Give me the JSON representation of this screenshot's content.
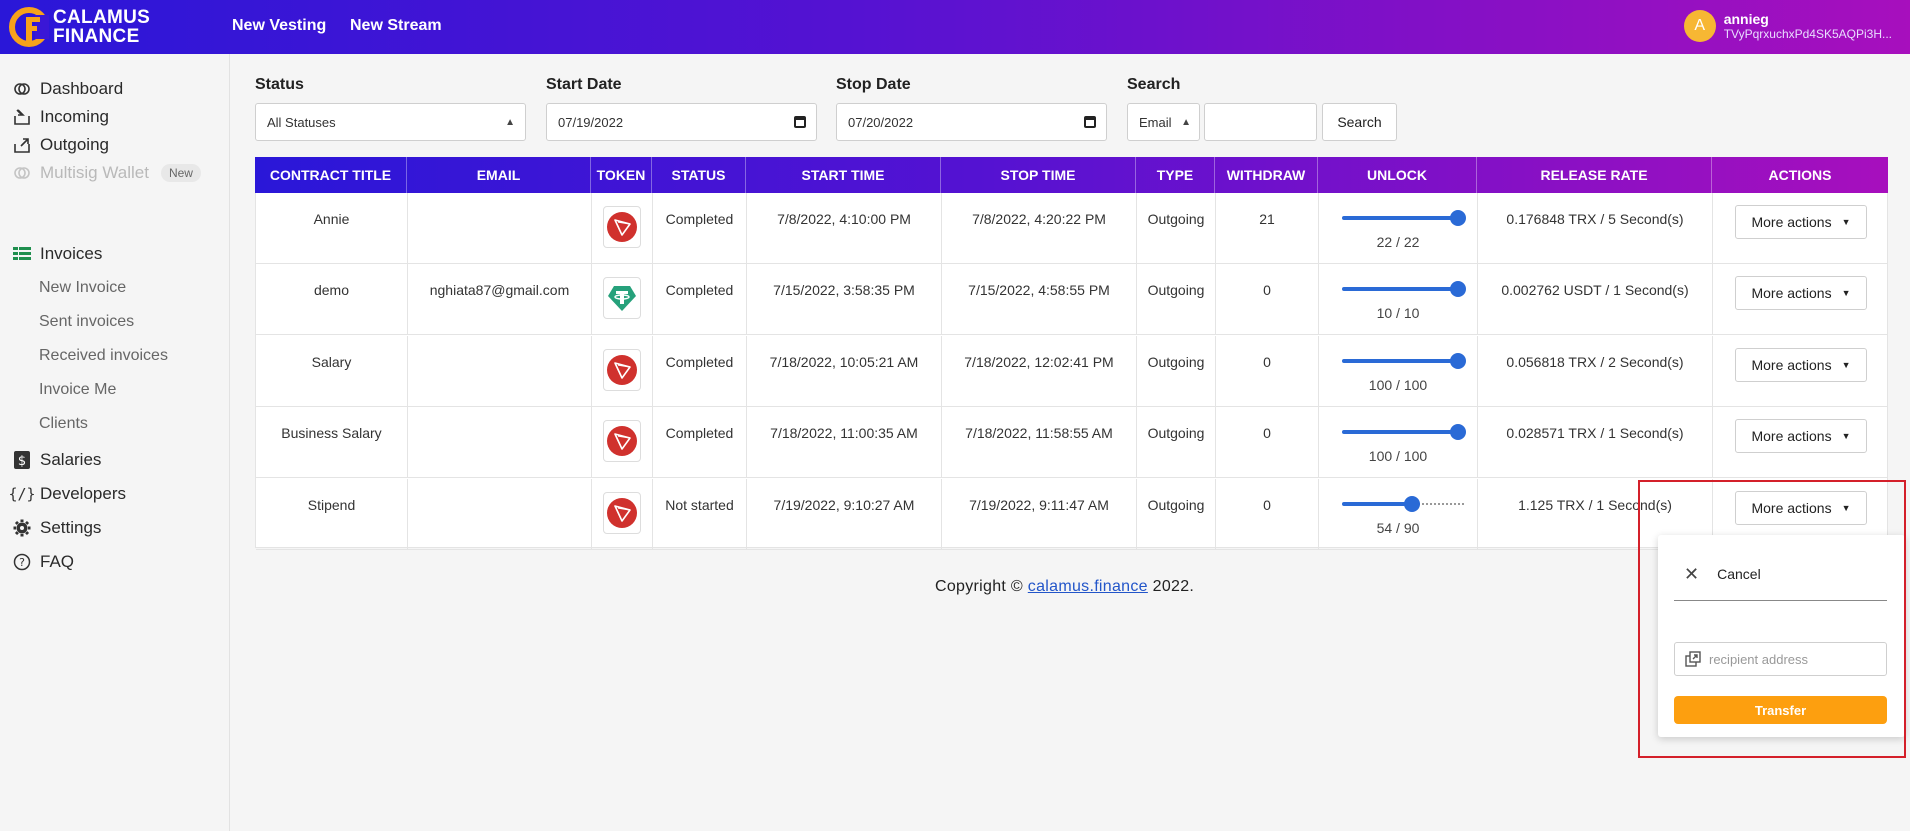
{
  "header": {
    "brand_line1": "CALAMUS",
    "brand_line2": "FINANCE",
    "nav": [
      "New Vesting",
      "New Stream"
    ],
    "user_initial": "A",
    "user_name": "annieg",
    "user_address": "TVyPqrxuchxPd4SK5AQPi3H..."
  },
  "sidebar": {
    "items": [
      {
        "label": "Dashboard",
        "icon": "dashboard-icon"
      },
      {
        "label": "Incoming",
        "icon": "incoming-icon"
      },
      {
        "label": "Outgoing",
        "icon": "outgoing-icon"
      },
      {
        "label": "Multisig Wallet",
        "icon": "multisig-icon",
        "badge": "New"
      },
      {
        "label": "Invoices",
        "icon": "invoices-icon"
      },
      {
        "label": "Salaries",
        "icon": "salaries-icon"
      },
      {
        "label": "Developers",
        "icon": "developers-icon"
      },
      {
        "label": "Settings",
        "icon": "gear-icon"
      },
      {
        "label": "FAQ",
        "icon": "help-icon"
      }
    ],
    "invoice_sub": [
      "New Invoice",
      "Sent invoices",
      "Received invoices",
      "Invoice Me",
      "Clients"
    ]
  },
  "filters": {
    "status_label": "Status",
    "status_value": "All Statuses",
    "start_label": "Start Date",
    "start_value": "07/19/2022",
    "stop_label": "Stop Date",
    "stop_value": "07/20/2022",
    "search_label": "Search",
    "search_type": "Email",
    "search_value": "",
    "search_button": "Search"
  },
  "table": {
    "columns": [
      "CONTRACT TITLE",
      "EMAIL",
      "TOKEN",
      "STATUS",
      "START TIME",
      "STOP TIME",
      "TYPE",
      "WITHDRAW",
      "UNLOCK",
      "RELEASE RATE",
      "ACTIONS"
    ],
    "rows": [
      {
        "title": "Annie",
        "email": "",
        "token": "tron-icon",
        "status": "Completed",
        "start": "7/8/2022, 4:10:00 PM",
        "stop": "7/8/2022, 4:20:22 PM",
        "type": "Outgoing",
        "withdraw": "21",
        "unlock": "22 / 22",
        "unlock_fraction": 1.0,
        "rate": "0.176848 TRX / 5 Second(s)",
        "action": "More actions"
      },
      {
        "title": "demo",
        "email": "nghiata87@gmail.com",
        "token": "tether-icon",
        "status": "Completed",
        "start": "7/15/2022, 3:58:35 PM",
        "stop": "7/15/2022, 4:58:55 PM",
        "type": "Outgoing",
        "withdraw": "0",
        "unlock": "10 / 10",
        "unlock_fraction": 1.0,
        "rate": "0.002762 USDT / 1 Second(s)",
        "action": "More actions"
      },
      {
        "title": "Salary",
        "email": "",
        "token": "tron-icon",
        "status": "Completed",
        "start": "7/18/2022, 10:05:21 AM",
        "stop": "7/18/2022, 12:02:41 PM",
        "type": "Outgoing",
        "withdraw": "0",
        "unlock": "100 / 100",
        "unlock_fraction": 1.0,
        "rate": "0.056818 TRX / 2 Second(s)",
        "action": "More actions"
      },
      {
        "title": "Business Salary",
        "email": "",
        "token": "tron-icon",
        "status": "Completed",
        "start": "7/18/2022, 11:00:35 AM",
        "stop": "7/18/2022, 11:58:55 AM",
        "type": "Outgoing",
        "withdraw": "0",
        "unlock": "100 / 100",
        "unlock_fraction": 1.0,
        "rate": "0.028571 TRX / 1 Second(s)",
        "action": "More actions"
      },
      {
        "title": "Stipend",
        "email": "",
        "token": "tron-icon",
        "status": "Not started",
        "start": "7/19/2022, 9:10:27 AM",
        "stop": "7/19/2022, 9:11:47 AM",
        "type": "Outgoing",
        "withdraw": "0",
        "unlock": "54 / 90",
        "unlock_fraction": 0.6,
        "rate": "1.125 TRX / 1 Second(s)",
        "action": "More actions"
      }
    ]
  },
  "footer": {
    "prefix": "Copyright © ",
    "link": "calamus.finance",
    "suffix": " 2022."
  },
  "popup": {
    "cancel": "Cancel",
    "address_placeholder": "recipient address",
    "transfer": "Transfer"
  },
  "colors": {
    "header_start": "#2a17d8",
    "header_end": "#a70fbd",
    "accent_blue": "#2a6ad6",
    "transfer_orange": "#fd9f0f",
    "tron_red": "#d0312d",
    "tether_green": "#26a17b"
  }
}
